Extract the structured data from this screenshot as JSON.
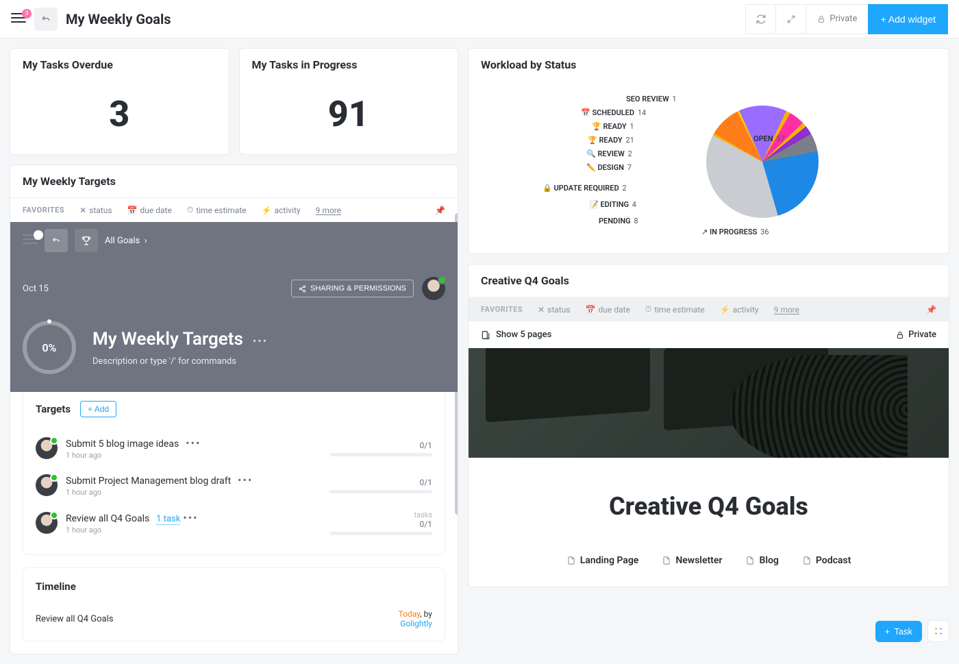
{
  "header": {
    "notification_count": "3",
    "title": "My Weekly Goals",
    "private_label": "Private",
    "add_widget_label": "+ Add widget"
  },
  "stats": {
    "overdue_title": "My Tasks Overdue",
    "overdue_value": "3",
    "progress_title": "My Tasks in Progress",
    "progress_value": "91"
  },
  "targets_panel": {
    "card_title": "My Weekly Targets",
    "fav": {
      "label": "FAVORITES",
      "status": "status",
      "due": "due date",
      "estimate": "time estimate",
      "activity": "activity",
      "more": "9 more"
    },
    "goals_link": "All Goals",
    "date": "Oct 15",
    "share_label": "SHARING & PERMISSIONS",
    "ring_value": "0%",
    "title": "My Weekly Targets",
    "desc": "Description or type '/' for commands",
    "section_title": "Targets",
    "add_label": "+ Add",
    "items": [
      {
        "name": "Submit 5 blog image ideas",
        "time": "1 hour ago",
        "frac": "0/1",
        "meta": ""
      },
      {
        "name": "Submit Project Management blog draft",
        "time": "1 hour ago",
        "frac": "0/1",
        "meta": ""
      },
      {
        "name": "Review all Q4 Goals",
        "time": "1 hour ago",
        "frac": "0/1",
        "meta": "tasks",
        "task_link": "1 task"
      }
    ],
    "timeline_title": "Timeline",
    "timeline_item": "Review all Q4 Goals",
    "timeline_today": "Today",
    "timeline_by": ", by",
    "timeline_user": "Golightly"
  },
  "workload": {
    "title": "Workload by Status"
  },
  "chart_data": {
    "type": "pie",
    "title": "Workload by Status",
    "series": [
      {
        "name": "SEO REVIEW",
        "value": 1,
        "color": "#f7b500",
        "icon": ""
      },
      {
        "name": "SCHEDULED",
        "value": 14,
        "color": "#ff7d1a",
        "icon": "📅"
      },
      {
        "name": "READY",
        "value": 1,
        "color": "#f6c90e",
        "icon": "🏆"
      },
      {
        "name": "READY",
        "value": 21,
        "color": "#9a6cff",
        "icon": "🏆"
      },
      {
        "name": "REVIEW",
        "value": 2,
        "color": "#f4b400",
        "icon": "🔍"
      },
      {
        "name": "DESIGN",
        "value": 7,
        "color": "#ff2ea6",
        "icon": "✏️"
      },
      {
        "name": "UPDATE REQUIRED",
        "value": 2,
        "color": "#f4b400",
        "icon": "🔒"
      },
      {
        "name": "EDITING",
        "value": 4,
        "color": "#8f2fd0",
        "icon": "📝"
      },
      {
        "name": "PENDING",
        "value": 8,
        "color": "#7a7f87",
        "icon": ""
      },
      {
        "name": "IN PROGRESS",
        "value": 36,
        "color": "#1e88e5",
        "icon": "↗"
      },
      {
        "name": "OPEN",
        "value": 57,
        "color": "#C9CCD1",
        "icon": ""
      }
    ]
  },
  "q4": {
    "card_title": "Creative Q4 Goals",
    "fav": {
      "label": "FAVORITES",
      "status": "status",
      "due": "due date",
      "estimate": "time estimate",
      "activity": "activity",
      "more": "9 more"
    },
    "show_pages": "Show 5 pages",
    "private": "Private",
    "big_title": "Creative Q4 Goals",
    "links": [
      "Landing Page",
      "Newsletter",
      "Blog",
      "Podcast"
    ]
  },
  "float": {
    "task": "Task"
  }
}
